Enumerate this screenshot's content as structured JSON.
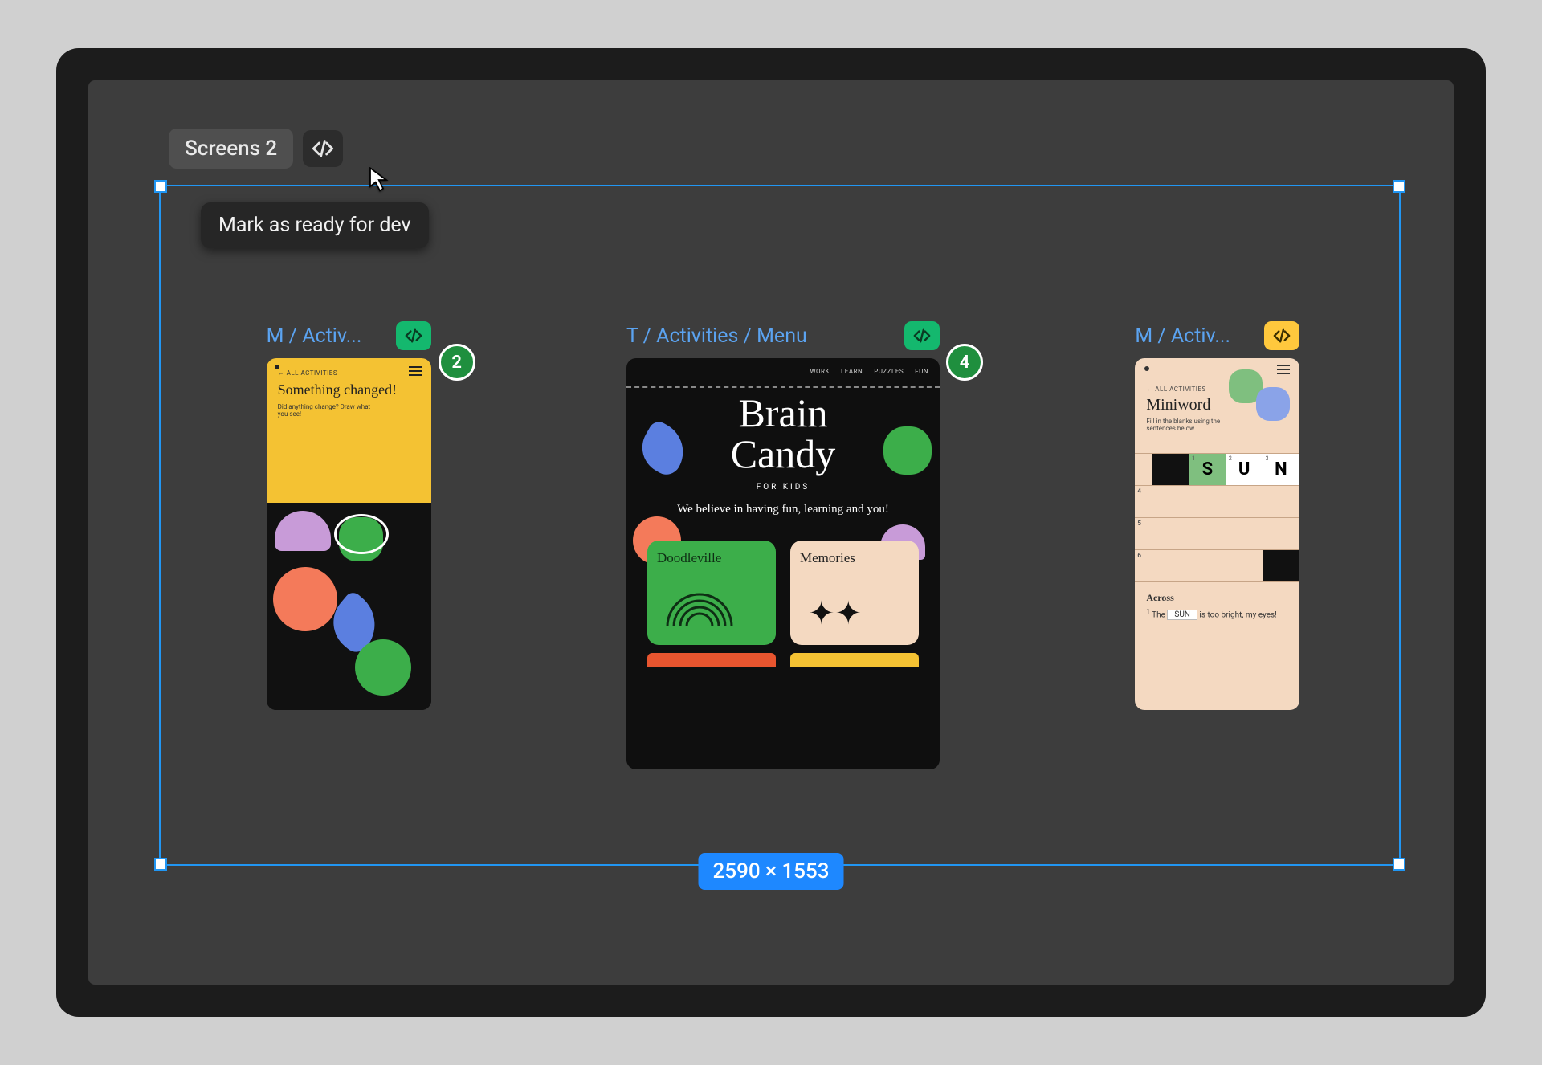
{
  "section": {
    "label": "Screens 2"
  },
  "tooltip": "Mark as ready for dev",
  "dimensions": "2590 × 1553",
  "pins": [
    {
      "count": "2"
    },
    {
      "count": "4"
    }
  ],
  "frames": [
    {
      "label": "M / Activ...",
      "badge": "green",
      "content": {
        "tag": "←  ALL ACTIVITIES",
        "title": "Something changed!",
        "sub": "Did anything change? Draw what you see!"
      }
    },
    {
      "label": "T / Activities / Menu",
      "badge": "green",
      "content": {
        "nav": [
          "WORK",
          "LEARN",
          "PUZZLES",
          "FUN"
        ],
        "title_l1": "Brain",
        "title_l2": "Candy",
        "tag": "FOR KIDS",
        "sub": "We believe in having fun, learning and you!",
        "card1": "Doodleville",
        "card2": "Memories"
      }
    },
    {
      "label": "M / Activ...",
      "badge": "yellow",
      "content": {
        "tag": "←  ALL ACTIVITIES",
        "title": "Miniword",
        "sub": "Fill in the blanks using the sentences below.",
        "letters": [
          "S",
          "U",
          "N"
        ],
        "across_label": "Across",
        "clue_num": "1",
        "clue_pre": "The",
        "clue_answer": "SUN",
        "clue_post": "is too bright, my eyes!"
      }
    }
  ]
}
